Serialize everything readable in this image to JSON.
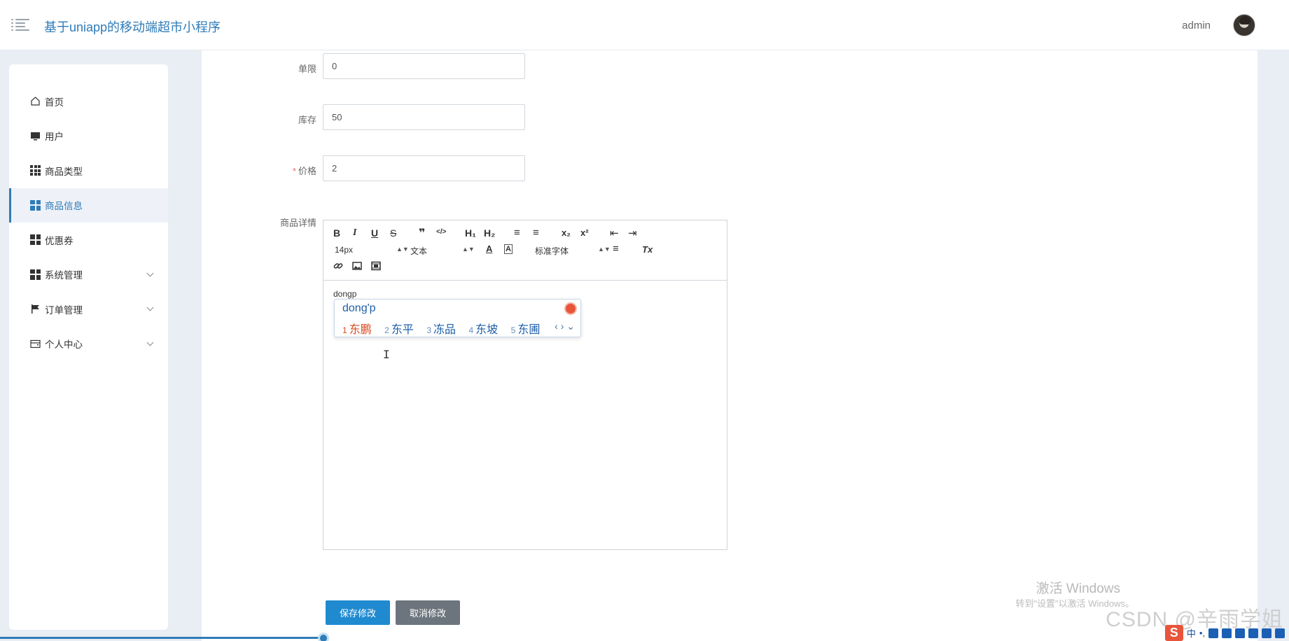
{
  "header": {
    "app_title": "基于uniapp的移动端超市小程序",
    "user_name": "admin"
  },
  "sidebar": {
    "items": [
      {
        "label": "首页",
        "icon": "home-icon"
      },
      {
        "label": "用户",
        "icon": "monitor-icon"
      },
      {
        "label": "商品类型",
        "icon": "grid-icon"
      },
      {
        "label": "商品信息",
        "icon": "grid-icon",
        "active": true
      },
      {
        "label": "优惠券",
        "icon": "grid-icon"
      },
      {
        "label": "系统管理",
        "icon": "grid-icon",
        "expandable": true
      },
      {
        "label": "订单管理",
        "icon": "flag-icon",
        "expandable": true
      },
      {
        "label": "个人中心",
        "icon": "wallet-icon",
        "expandable": true
      }
    ]
  },
  "form": {
    "limit": {
      "label": "单限",
      "value": "0"
    },
    "stock": {
      "label": "库存",
      "value": "50"
    },
    "price": {
      "label": "价格",
      "value": "2",
      "required": true
    },
    "detail": {
      "label": "商品详情"
    }
  },
  "editor": {
    "toolbar": {
      "bold": "B",
      "italic": "I",
      "underline": "U",
      "strike": "S",
      "blockquote": "❞",
      "code": "</>",
      "h1": "H₁",
      "h2": "H₂",
      "ordered_list": "≡",
      "bullet_list": "≡",
      "subscript": "x₂",
      "superscript": "x²",
      "outdent": "⇤",
      "indent": "⇥",
      "size": "14px",
      "header": "文本",
      "font": "标准字体",
      "align": "≡",
      "clean": "Tx"
    },
    "typed_text": "dongp",
    "ime": {
      "composition": "dong'p",
      "candidates": [
        {
          "n": "1",
          "text": "东鹏"
        },
        {
          "n": "2",
          "text": "东平"
        },
        {
          "n": "3",
          "text": "冻品"
        },
        {
          "n": "4",
          "text": "东坡"
        },
        {
          "n": "5",
          "text": "东圃"
        }
      ],
      "nav": "‹ › ⌄"
    },
    "cursor": "I"
  },
  "actions": {
    "save": "保存修改",
    "cancel": "取消修改"
  },
  "watermark": {
    "line1": "激活 Windows",
    "line2": "转到\"设置\"以激活 Windows。",
    "csdn": "CSDN @辛雨学姐"
  },
  "tray": {
    "ime_mode": "中",
    "punct": "•,"
  },
  "colors": {
    "accent": "#2f7cb8",
    "save_button": "#1f8ad0",
    "cancel_button": "#6c757d",
    "required": "#e86a6a"
  }
}
